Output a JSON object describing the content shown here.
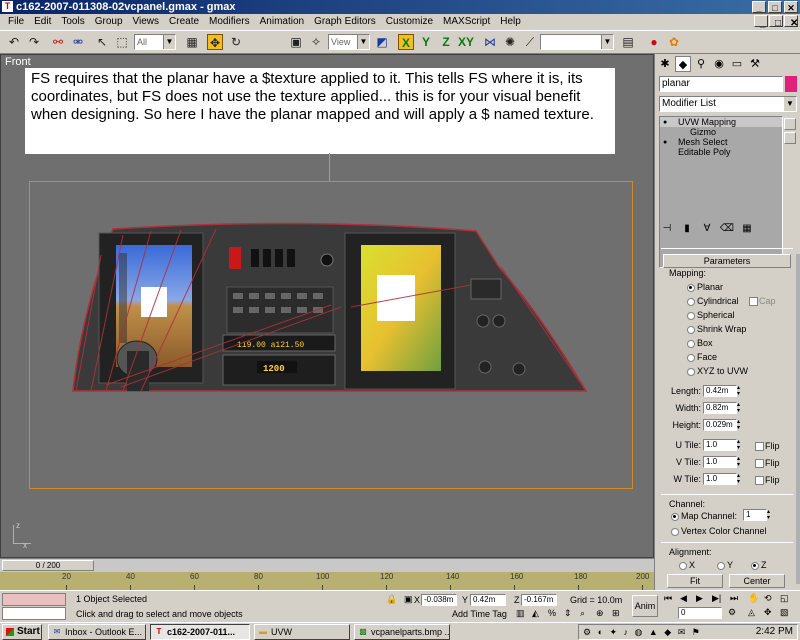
{
  "window": {
    "title": "c162-2007-011308-02vcpanel.gmax - gmax",
    "app_icon": "gmax-icon",
    "controls": [
      "_",
      "□",
      "✕"
    ]
  },
  "menu": [
    "File",
    "Edit",
    "Tools",
    "Group",
    "Views",
    "Create",
    "Modifiers",
    "Animation",
    "Graph Editors",
    "Customize",
    "MAXScript",
    "Help"
  ],
  "toolbar": {
    "selection_filter": "All",
    "coord_system": "View"
  },
  "viewport": {
    "label": "Front",
    "note": "FS requires that the planar have a $texture applied to it.  This tells FS where it is, its coordinates, but FS does not use the texture applied... this is for your visual benefit when designing.  So here I have the planar mapped and will apply a $ named texture.",
    "axis_x": "x",
    "axis_y": "z"
  },
  "panel_instruments": {
    "readout_freq": "119.00  a121.50",
    "readout_xpdr": "1200"
  },
  "command_panel": {
    "object_name": "planar",
    "object_color": "#e0207a",
    "modifier_list": "Modifier List",
    "stack": [
      {
        "label": "UVW Mapping",
        "selected": true
      },
      {
        "label": "Gizmo",
        "selected": false
      },
      {
        "label": "Mesh Select",
        "selected": false
      },
      {
        "label": "Editable Poly",
        "selected": false
      }
    ],
    "rollout_title": "Parameters",
    "mapping_label": "Mapping:",
    "mapping_options": [
      "Planar",
      "Cylindrical",
      "Spherical",
      "Shrink Wrap",
      "Box",
      "Face",
      "XYZ to UVW"
    ],
    "cap_label": "Cap",
    "length_label": "Length:",
    "length_value": "0.42m",
    "width_label": "Width:",
    "width_value": "0.82m",
    "height_label": "Height:",
    "height_value": "0.029m",
    "utile_label": "U Tile:",
    "utile_value": "1.0",
    "vtile_label": "V Tile:",
    "vtile_value": "1.0",
    "wtile_label": "W Tile:",
    "wtile_value": "1.0",
    "flip_label": "Flip",
    "channel_label": "Channel:",
    "map_channel_label": "Map Channel:",
    "map_channel_value": "1",
    "vertex_color_label": "Vertex Color Channel",
    "alignment_label": "Alignment:",
    "align_x": "X",
    "align_y": "Y",
    "align_z": "Z",
    "fit_label": "Fit",
    "center_label": "Center"
  },
  "timeline": {
    "slider_label": "0 / 200",
    "ruler_labels": [
      "20",
      "40",
      "60",
      "80",
      "100",
      "120",
      "140",
      "160",
      "180",
      "200"
    ]
  },
  "status": {
    "selected_text": "1 Object Selected",
    "prompt_text": "Click and drag to select and move objects",
    "x_label": "X",
    "x_value": "-0.038m",
    "y_label": "Y",
    "y_value": "0.42m",
    "z_label": "Z",
    "z_value": "-0.167m",
    "grid_text": "Grid = 10.0m",
    "add_time_tag": "Add Time Tag",
    "anim_label": "Anim",
    "frame_value": "0"
  },
  "taskbar": {
    "start_label": "Start",
    "tasks": [
      {
        "label": "Inbox - Outlook E...",
        "icon": "outlook-icon",
        "active": false
      },
      {
        "label": "c162-2007-011...",
        "icon": "gmax-icon",
        "active": true
      },
      {
        "label": "UVW",
        "icon": "folder-icon",
        "active": false
      },
      {
        "label": "vcpanelparts.bmp ...",
        "icon": "paint-icon",
        "active": false
      }
    ],
    "clock": "2:42 PM"
  }
}
